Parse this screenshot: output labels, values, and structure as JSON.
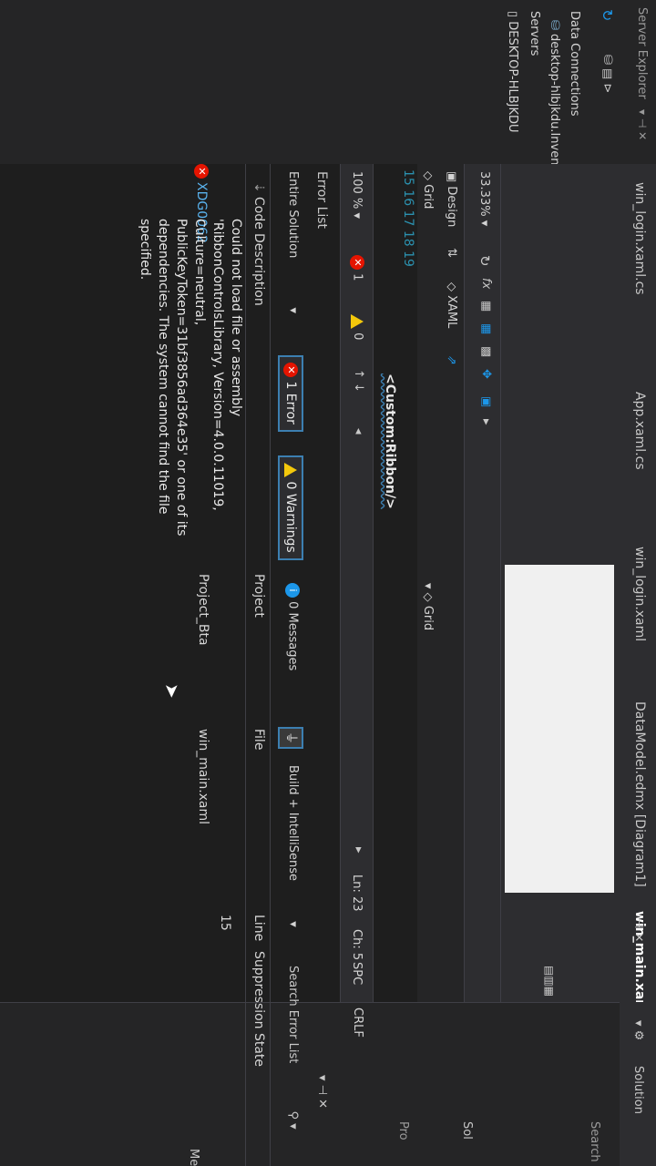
{
  "tabs": {
    "active": "win_main.xaml*",
    "items": [
      "DataModel.edmx [Diagram1]",
      "win_login.xaml",
      "App.xaml.cs",
      "win_login.xaml.cs"
    ],
    "pin": "⊣ ✕"
  },
  "server_explorer": {
    "title": "Server Explorer",
    "pin": "▾ ⊣ ✕",
    "data_connections": "Data Connections",
    "connection": "desktop-hlbjkdu.Invent",
    "servers": "Servers",
    "desktop": "DESKTOP-HLBJKDU"
  },
  "solution_explorer": {
    "title": "Solution",
    "search": "Search S",
    "sol": "Sol",
    "pro": "Pro",
    "me": "Me"
  },
  "designer": {
    "zoom": "33.33%",
    "design_tab": "Design",
    "swap": "⇅",
    "xaml_tab": "XAML",
    "grid_breadcrumb_left": "Grid",
    "grid_breadcrumb_right": "Grid"
  },
  "editor": {
    "line_numbers": [
      "15",
      "16",
      "17",
      "18",
      "19"
    ],
    "code": "<Custom:Ribbon/>"
  },
  "status": {
    "zoom": "100 %",
    "errors": "1",
    "warnings": "0",
    "ln": "Ln: 23",
    "ch": "Ch: 5",
    "spc": "SPC",
    "crlf": "CRLF"
  },
  "error_list": {
    "title": "Error List",
    "pin": "▾ ⊣ ✕",
    "scope": "Entire Solution",
    "errors_btn": "1 Error",
    "warnings_btn": "0 Warnings",
    "messages_btn": "0 Messages",
    "build": "Build + IntelliSense",
    "search": "Search Error List",
    "columns": {
      "code": "Code",
      "description": "Description",
      "project": "Project",
      "file": "File",
      "line": "Line",
      "suppression": "Suppression State"
    },
    "row": {
      "code": "XDG0062",
      "description": "Could not load file or assembly 'RibbonControlsLibrary, Version=4.0.0.11019, Culture=neutral, PublicKeyToken=31bf3856ad364e35' or one of its dependencies. The system cannot find the file specified.",
      "project": "Project_Bta",
      "file": "win_main.xaml",
      "line": "15"
    }
  }
}
